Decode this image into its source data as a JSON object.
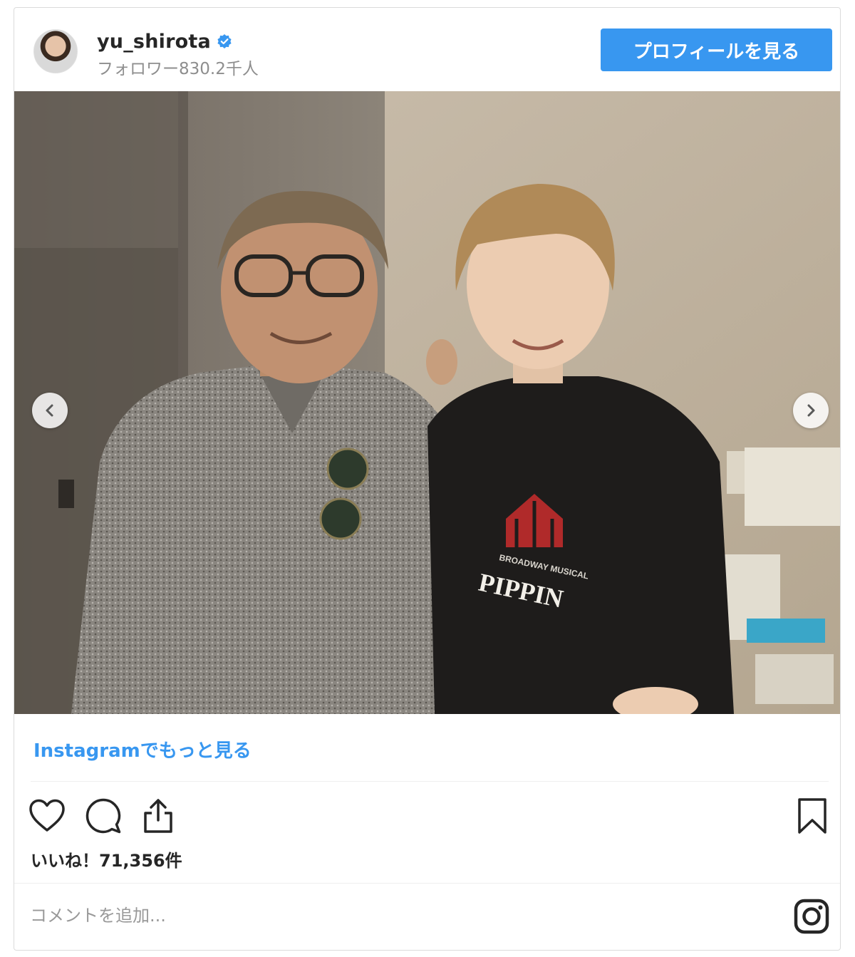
{
  "header": {
    "username": "yu_shirota",
    "followers": "フォロワー830.2千人",
    "profile_button": "プロフィールを見る"
  },
  "photo": {
    "shirt_text_top": "BROADWAY MUSICAL",
    "shirt_text_main": "PIPPIN"
  },
  "more_link": "Instagramでもっと見る",
  "likes": "いいね！71,356件",
  "comment": {
    "placeholder": "コメントを追加..."
  },
  "icons": [
    "verified-badge-icon",
    "chevron-left-icon",
    "chevron-right-icon",
    "heart-icon",
    "comment-icon",
    "share-icon",
    "bookmark-icon",
    "instagram-icon"
  ],
  "colors": {
    "accent": "#3897f0",
    "text": "#262626",
    "secondary": "#8e8e8e"
  }
}
